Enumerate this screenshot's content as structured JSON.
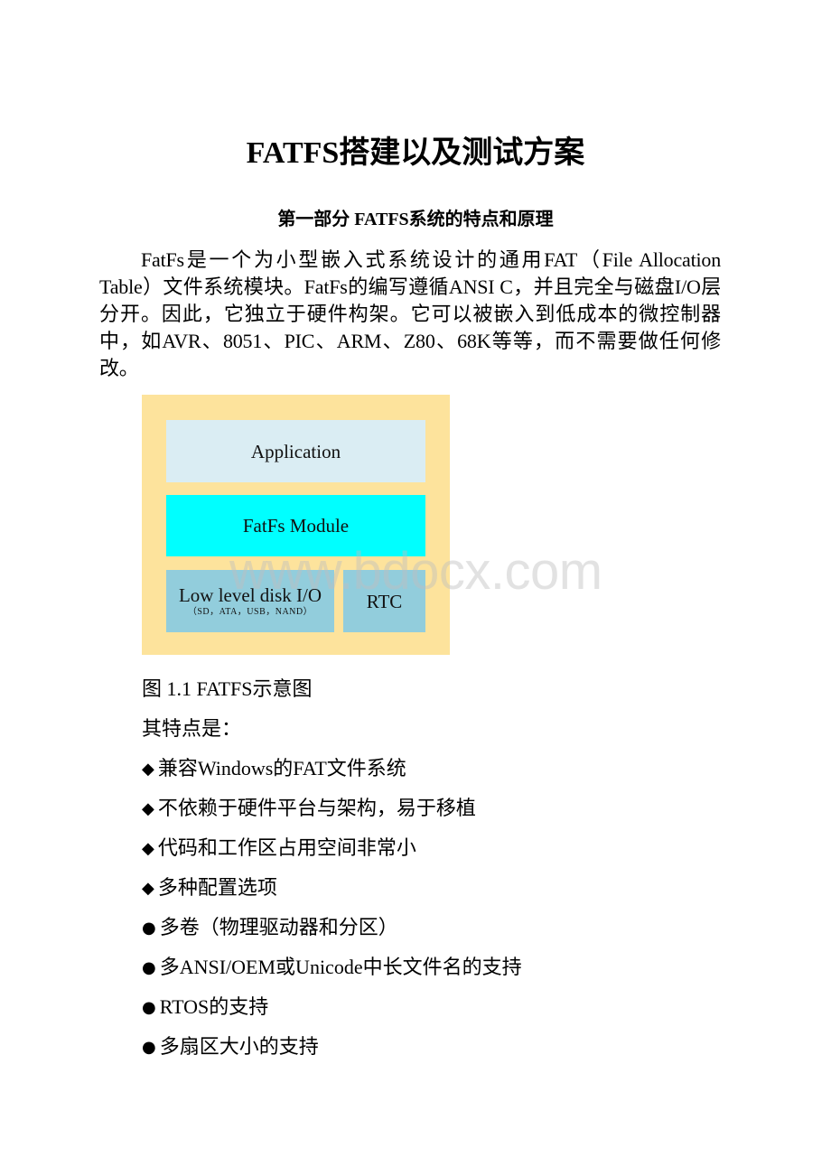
{
  "document": {
    "title": "FATFS搭建以及测试方案",
    "section_heading": "第一部分 FATFS系统的特点和原理",
    "intro_paragraph": "FatFs是一个为小型嵌入式系统设计的通用FAT（File Allocation Table）文件系统模块。FatFs的编写遵循ANSI C，并且完全与磁盘I/O层分开。因此，它独立于硬件构架。它可以被嵌入到低成本的微控制器中，如AVR、8051、PIC、ARM、Z80、68K等等，而不需要做任何修改。"
  },
  "diagram": {
    "colors": {
      "background": "#fde39c",
      "application": "#daedf3",
      "fatfs_module": "#00ffff",
      "low_level": "#92cddc"
    },
    "layers": {
      "application": "Application",
      "fatfs_module": "FatFs Module",
      "low_level_disk_io": "Low level disk I/O",
      "low_level_disk_io_sub": "（SD，ATA，USB，NAND）",
      "rtc": "RTC"
    },
    "caption": "图 1.1 FATFS示意图"
  },
  "watermark": "www.bdocx.com",
  "features": {
    "intro": "其特点是：",
    "items": [
      {
        "bullet": "◆",
        "bullet_icon": "diamond-bullet-icon",
        "text": "兼容Windows的FAT文件系统"
      },
      {
        "bullet": "◆",
        "bullet_icon": "diamond-bullet-icon",
        "text": "不依赖于硬件平台与架构，易于移植"
      },
      {
        "bullet": "◆",
        "bullet_icon": "diamond-bullet-icon",
        "text": "代码和工作区占用空间非常小"
      },
      {
        "bullet": "◆",
        "bullet_icon": "diamond-bullet-icon",
        "text": "多种配置选项"
      },
      {
        "bullet": "●",
        "bullet_icon": "dot-bullet-icon",
        "text": "多卷（物理驱动器和分区）"
      },
      {
        "bullet": "●",
        "bullet_icon": "dot-bullet-icon",
        "text": "多ANSI/OEM或Unicode中长文件名的支持"
      },
      {
        "bullet": "●",
        "bullet_icon": "dot-bullet-icon",
        "text": "RTOS的支持"
      },
      {
        "bullet": "●",
        "bullet_icon": "dot-bullet-icon",
        "text": "多扇区大小的支持"
      }
    ]
  }
}
